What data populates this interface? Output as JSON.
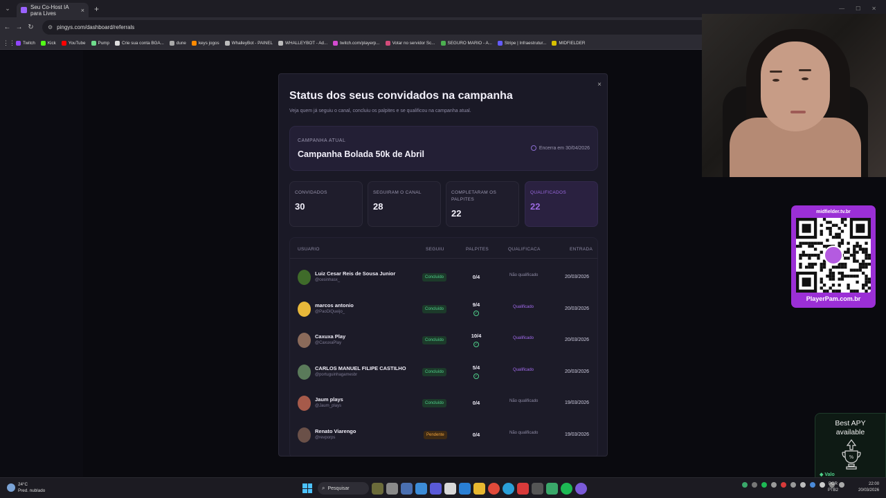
{
  "browser": {
    "tab_title": "Seu Co-Host IA para Lives",
    "url": "pingys.com/dashboard/referrals",
    "bookmarks": [
      {
        "label": "Twitch",
        "color": "#9146ff"
      },
      {
        "label": "Kick",
        "color": "#53fc18"
      },
      {
        "label": "YouTube",
        "color": "#ff0000"
      },
      {
        "label": "Pump",
        "color": "#6fdc8c"
      },
      {
        "label": "Crie sua conta BGA...",
        "color": "#dddddd"
      },
      {
        "label": "dune",
        "color": "#aaaaaa"
      },
      {
        "label": "keys jogos",
        "color": "#ff8a00"
      },
      {
        "label": "WhalleyBot - PAINEL",
        "color": "#bbbbbb"
      },
      {
        "label": "WHALLEYBOT - Ad...",
        "color": "#bbbbbb"
      },
      {
        "label": "twitch.com/playerp...",
        "color": "#d34bd0"
      },
      {
        "label": "Votar no servidor Sc...",
        "color": "#d34b7a"
      },
      {
        "label": "SEGURO MARIO - A...",
        "color": "#4caf50"
      },
      {
        "label": "Stripe | Infraestrutur...",
        "color": "#635bff"
      },
      {
        "label": "MIDFIELDER",
        "color": "#d8c000"
      }
    ]
  },
  "modal": {
    "title": "Status dos seus convidados na campanha",
    "subtitle": "Veja quem já seguiu o canal, concluiu os palpites e se qualificou na campanha atual.",
    "campaign_label": "CAMPANHA ATUAL",
    "campaign_name": "Campanha Bolada 50k de Abril",
    "ends_text": "Encerra em 30/04/2026",
    "close": "×",
    "stats": [
      {
        "label": "CONVIDADOS",
        "value": "30"
      },
      {
        "label": "SEGUIRAM O CANAL",
        "value": "28"
      },
      {
        "label": "COMPLETARAM OS PALPITES",
        "value": "22"
      },
      {
        "label": "QUALIFICADOS",
        "value": "22"
      }
    ],
    "columns": [
      "USUARIO",
      "SEGUIU",
      "PALPITES",
      "QUALIFICACAO",
      "ENTRADA"
    ],
    "rows": [
      {
        "name": "Luiz Cesar Reis de Sousa Junior",
        "handle": "@cesinhasx_",
        "status": "Concluído",
        "picks": "0/4",
        "check": false,
        "qualification": "Não qualificado",
        "qualified": false,
        "date": "20/03/2026",
        "avatar": "#3f6b2a"
      },
      {
        "name": "marcos antonio",
        "handle": "@PaoDiQueijo_",
        "status": "Concluído",
        "picks": "9/4",
        "check": true,
        "qualification": "Qualificado",
        "qualified": true,
        "date": "20/03/2026",
        "avatar": "#e8b83a"
      },
      {
        "name": "Caxuxa Play",
        "handle": "@CaxuxaPlay",
        "status": "Concluído",
        "picks": "10/4",
        "check": true,
        "qualification": "Qualificado",
        "qualified": true,
        "date": "20/03/2026",
        "avatar": "#8a6a5a"
      },
      {
        "name": "CARLOS MANUEL FILIPE CASTILHO",
        "handle": "@portuguinhagamesbr",
        "status": "Concluído",
        "picks": "5/4",
        "check": true,
        "qualification": "Qualificado",
        "qualified": true,
        "date": "20/03/2026",
        "avatar": "#5a7a5a"
      },
      {
        "name": "Jaum plays",
        "handle": "@Jaum_plays",
        "status": "Concluído",
        "picks": "0/4",
        "check": false,
        "qualification": "Não qualificado",
        "qualified": false,
        "date": "19/03/2026",
        "avatar": "#a65a4a"
      },
      {
        "name": "Renato Viarengo",
        "handle": "@revporps",
        "status": "Pendente",
        "picks": "0/4",
        "check": false,
        "qualification": "Não qualificado",
        "qualified": false,
        "date": "19/03/2026",
        "avatar": "#6a5048"
      }
    ]
  },
  "overlay": {
    "qr_top": "midfielder.tv.br",
    "qr_bottom": "PlayerPam.com.br",
    "apy_line1": "Best APY",
    "apy_line2": "available",
    "apy_brand": "Valo"
  },
  "taskbar": {
    "temp": "24°C",
    "weather": "Pred. nublado",
    "search": "Pesquisar",
    "lang1": "POR",
    "lang2": "PTB2",
    "time": "22:00",
    "date": "20/03/2026"
  }
}
